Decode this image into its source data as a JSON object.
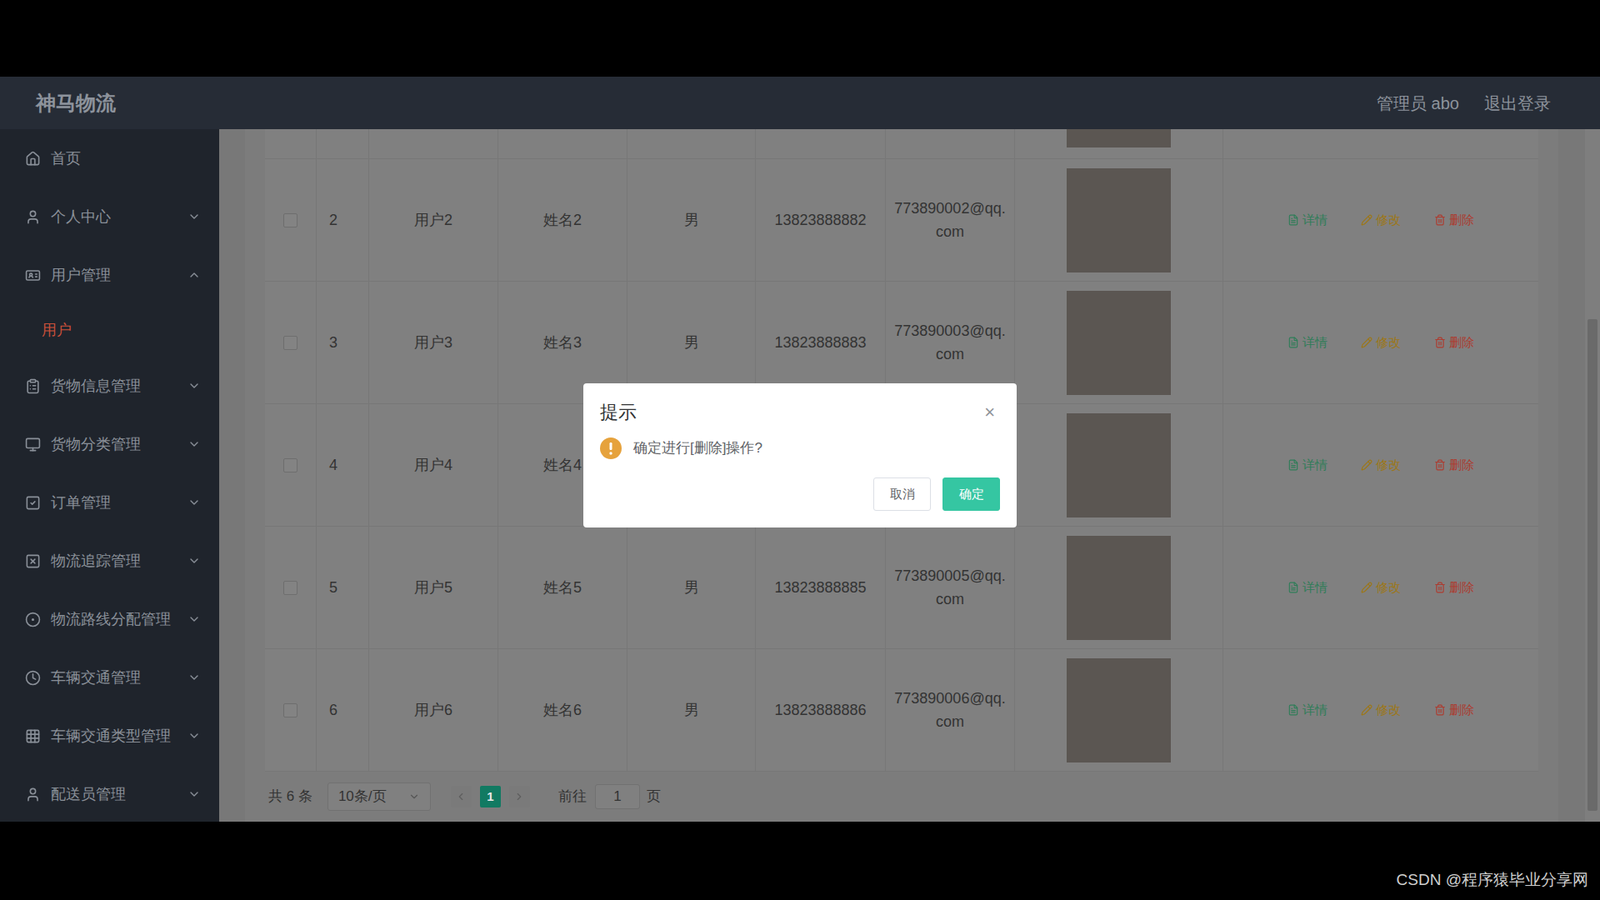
{
  "header": {
    "brand": "神马物流",
    "user": "管理员 abo",
    "logout": "退出登录"
  },
  "sidebar": {
    "items": [
      {
        "label": "首页",
        "expandable": false,
        "expanded": false,
        "children": []
      },
      {
        "label": "个人中心",
        "expandable": true,
        "expanded": false,
        "children": []
      },
      {
        "label": "用户管理",
        "expandable": true,
        "expanded": true,
        "children": [
          {
            "label": "用户",
            "selected": true
          }
        ]
      },
      {
        "label": "货物信息管理",
        "expandable": true,
        "expanded": false,
        "children": []
      },
      {
        "label": "货物分类管理",
        "expandable": true,
        "expanded": false,
        "children": []
      },
      {
        "label": "订单管理",
        "expandable": true,
        "expanded": false,
        "children": []
      },
      {
        "label": "物流追踪管理",
        "expandable": true,
        "expanded": false,
        "children": []
      },
      {
        "label": "物流路线分配管理",
        "expandable": true,
        "expanded": false,
        "children": []
      },
      {
        "label": "车辆交通管理",
        "expandable": true,
        "expanded": false,
        "children": []
      },
      {
        "label": "车辆交通类型管理",
        "expandable": true,
        "expanded": false,
        "children": []
      },
      {
        "label": "配送员管理",
        "expandable": true,
        "expanded": false,
        "children": []
      }
    ]
  },
  "table": {
    "actions": [
      {
        "label": "详情",
        "color": "#2f7d58"
      },
      {
        "label": "修改",
        "color": "#9c7718"
      },
      {
        "label": "删除",
        "color": "#ad3a2e"
      }
    ],
    "rows": [
      {
        "index": "2",
        "username": "用户2",
        "name": "姓名2",
        "gender": "男",
        "phone": "13823888882",
        "email": "773890002@qq.com",
        "checked": false
      },
      {
        "index": "3",
        "username": "用户3",
        "name": "姓名3",
        "gender": "男",
        "phone": "13823888883",
        "email": "773890003@qq.com",
        "checked": false
      },
      {
        "index": "4",
        "username": "用户4",
        "name": "姓名4",
        "gender": null,
        "phone": null,
        "email": null,
        "checked": false
      },
      {
        "index": "5",
        "username": "用户5",
        "name": "姓名5",
        "gender": "男",
        "phone": "13823888885",
        "email": "773890005@qq.com",
        "checked": false
      },
      {
        "index": "6",
        "username": "用户6",
        "name": "姓名6",
        "gender": "男",
        "phone": "13823888886",
        "email": "773890006@qq.com",
        "checked": false
      }
    ]
  },
  "pagination": {
    "total": "共 6 条",
    "page_size": "10条/页",
    "pages": [
      {
        "label": "1",
        "selected": true
      }
    ],
    "goto_label": "前往",
    "goto_value": "1",
    "goto_suffix": "页"
  },
  "dialog": {
    "title": "提示",
    "close": "×",
    "message": "确定进行[删除]操作?",
    "buttons": [
      {
        "label": "取消",
        "primary": false
      },
      {
        "label": "确定",
        "primary": true
      }
    ]
  },
  "watermark": "CSDN @程序猿毕业分享网"
}
